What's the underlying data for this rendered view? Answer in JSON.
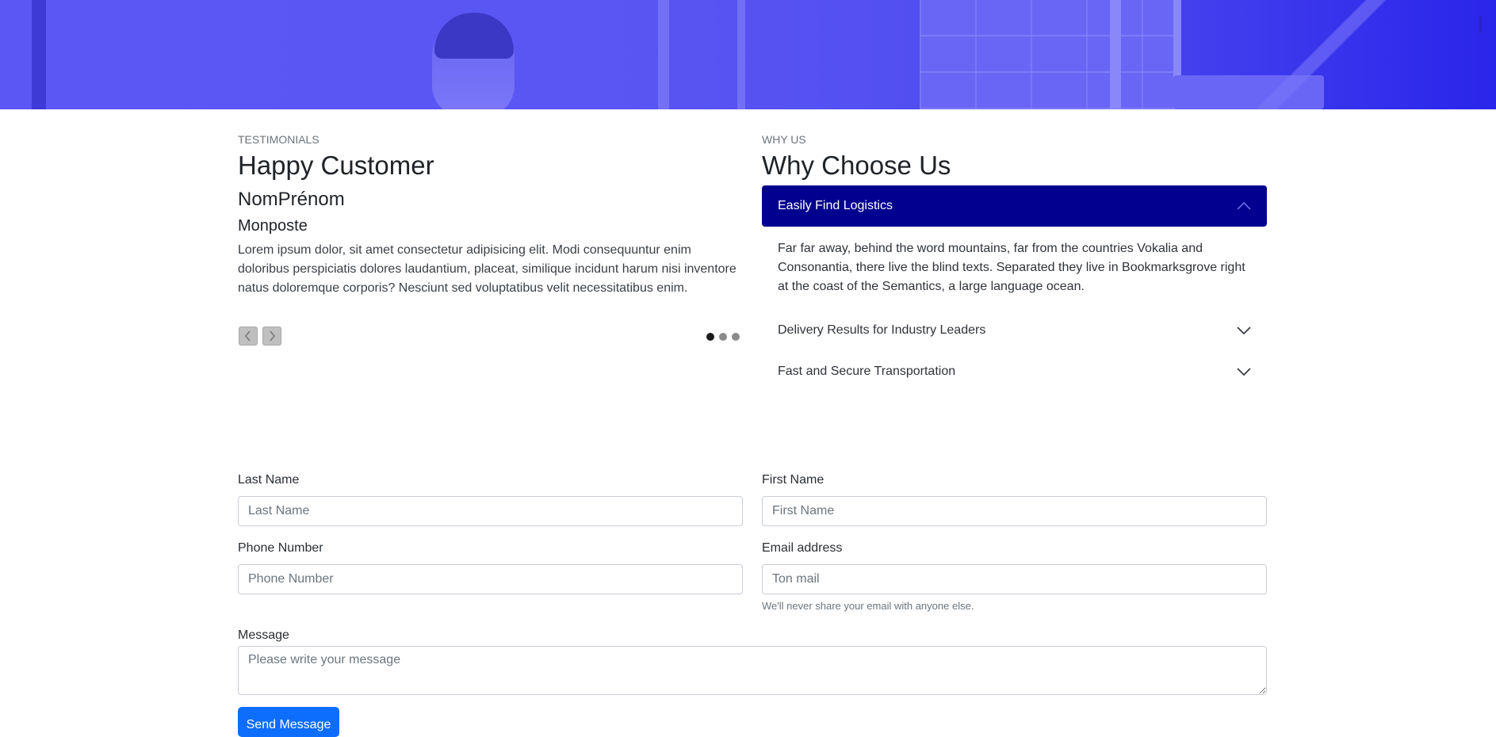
{
  "colors": {
    "hero_overlay": "#5b57f4",
    "accordion_active": "#02008e",
    "primary_button": "#0d6efd"
  },
  "testimonials": {
    "subheading": "TESTIMONIALS",
    "title": "Happy Customer",
    "name": "NomPrénom",
    "role": "Monposte",
    "quote": "Lorem ipsum dolor, sit amet consectetur adipisicing elit. Modi consequuntur enim doloribus perspiciatis dolores laudantium, placeat, similique incidunt harum nisi inventore natus doloremque corporis? Nesciunt sed voluptatibus velit necessitatibus enim.",
    "prev_icon": "chevron-left-icon",
    "next_icon": "chevron-right-icon",
    "slide_count": 3,
    "active_slide": 1
  },
  "why_us": {
    "subheading": "WHY US",
    "title": "Why Choose Us",
    "items": [
      {
        "title": "Easily Find Logistics",
        "expanded": true,
        "body": "Far far away, behind the word mountains, far from the countries Vokalia and Consonantia, there live the blind texts. Separated they live in Bookmarksgrove right at the coast of the Semantics, a large language ocean."
      },
      {
        "title": "Delivery Results for Industry Leaders",
        "expanded": false
      },
      {
        "title": "Fast and Secure Transportation",
        "expanded": false
      }
    ]
  },
  "contact_form": {
    "last_name": {
      "label": "Last Name",
      "placeholder": "Last Name"
    },
    "first_name": {
      "label": "First Name",
      "placeholder": "First Name"
    },
    "phone": {
      "label": "Phone Number",
      "placeholder": "Phone Number"
    },
    "email": {
      "label": "Email address",
      "placeholder": "Ton mail",
      "help": "We'll never share your email with anyone else."
    },
    "message": {
      "label": "Message",
      "placeholder": "Please write your message"
    },
    "submit_label": "Send Message"
  }
}
